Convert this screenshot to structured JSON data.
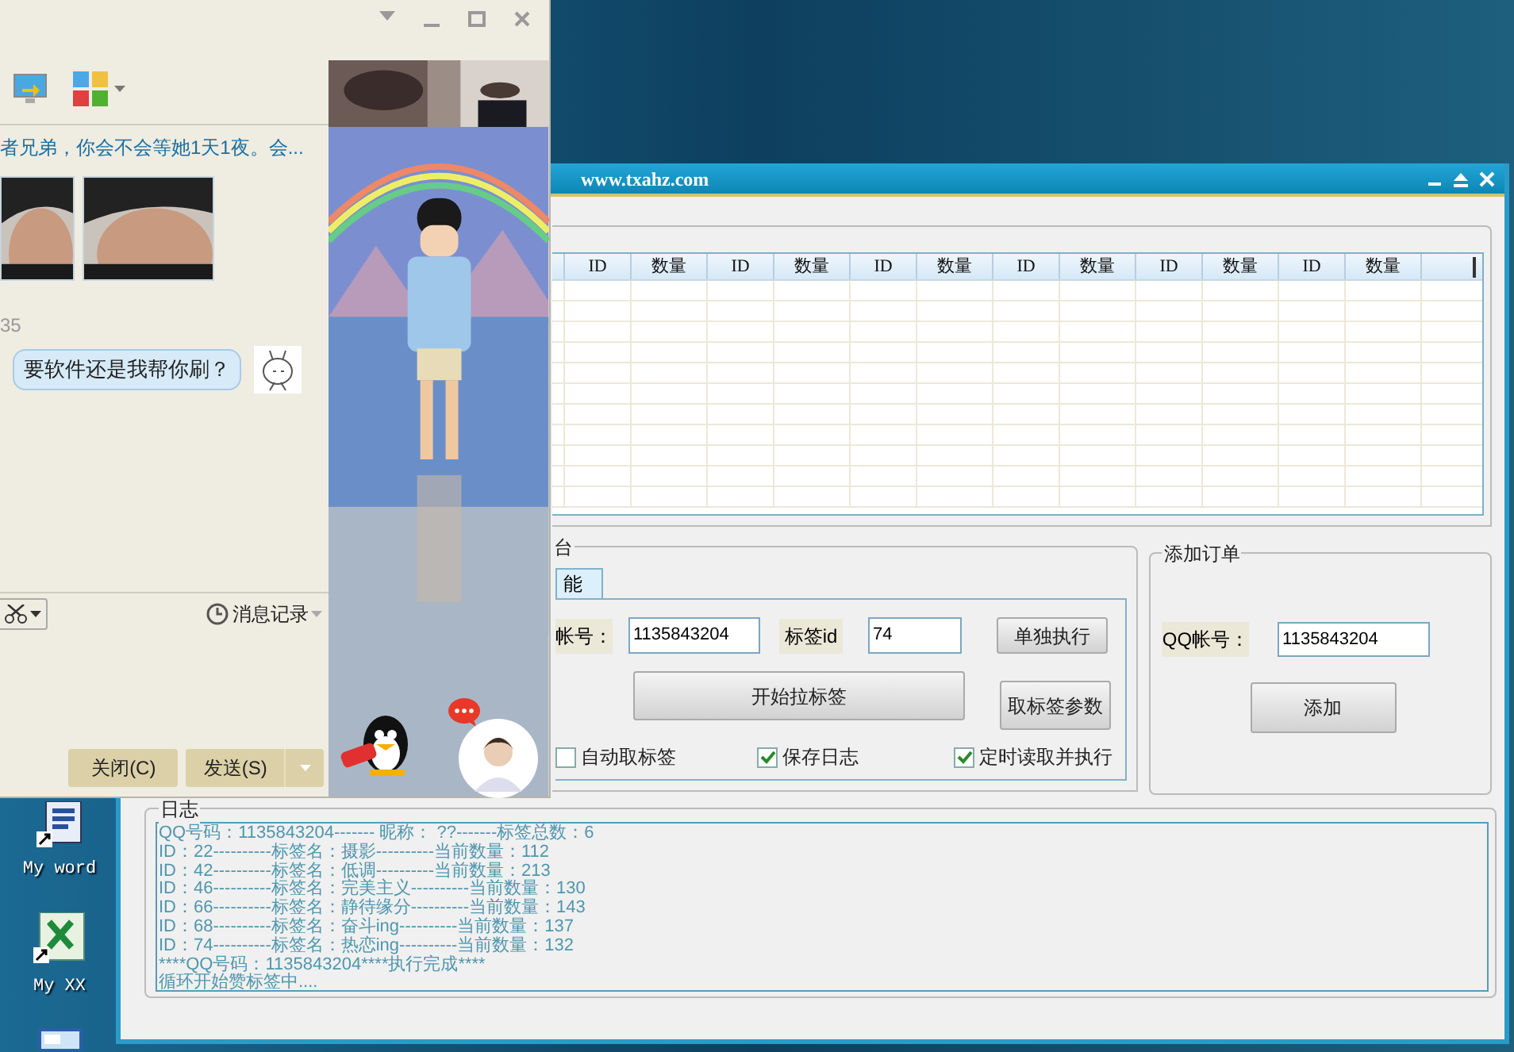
{
  "desktop": {
    "icons": [
      {
        "kind": "word",
        "label": "My word"
      },
      {
        "kind": "sheet",
        "label": "My XX"
      },
      {
        "kind": "window"
      }
    ]
  },
  "chat_window": {
    "message_preview": "者兄弟，你会不会等她1天1夜。会...",
    "timestamp": "35",
    "bubble": "要软件还是我帮你刷？",
    "history_button": "消息记录",
    "buttons": [
      {
        "label": "关闭(C)"
      },
      {
        "label": "发送(S)"
      }
    ]
  },
  "tool_window": {
    "title": "www.txahz.com",
    "table": {
      "columns": [
        "ID",
        "数量",
        "ID",
        "数量",
        "ID",
        "数量",
        "ID",
        "数量",
        "ID",
        "数量",
        "ID",
        "数量"
      ]
    },
    "control_group": {
      "title": "台",
      "tab": {
        "label": "能",
        "selected": true
      },
      "fields": [
        {
          "label": "帐号：",
          "value": "1135843204"
        },
        {
          "label": "标签id",
          "value": "74"
        }
      ],
      "buttons": [
        "单独执行",
        "开始拉标签",
        "取标签参数"
      ],
      "checkboxes": [
        {
          "label": "自动取标签",
          "checked": false
        },
        {
          "label": "保存日志",
          "checked": true
        },
        {
          "label": "定时读取并执行",
          "checked": true
        }
      ]
    },
    "order_group": {
      "title": "添加订单",
      "field": {
        "label": "QQ帐号：",
        "value": "1135843204"
      },
      "button": "添加"
    },
    "log": {
      "title": "日志",
      "lines": [
        "QQ号码：1135843204-------  昵称： ??-------标签总数：6",
        "ID：22----------标签名：摄影----------当前数量：112",
        "ID：42----------标签名：低调----------当前数量：213",
        "ID：46----------标签名：完美主义----------当前数量：130",
        "ID：66----------标签名：静待缘分----------当前数量：143",
        "ID：68----------标签名：奋斗ing----------当前数量：137",
        "ID：74----------标签名：热恋ing----------当前数量：132",
        "****QQ号码：1135843204****执行完成****",
        "循环开始赞标签中...."
      ]
    }
  }
}
